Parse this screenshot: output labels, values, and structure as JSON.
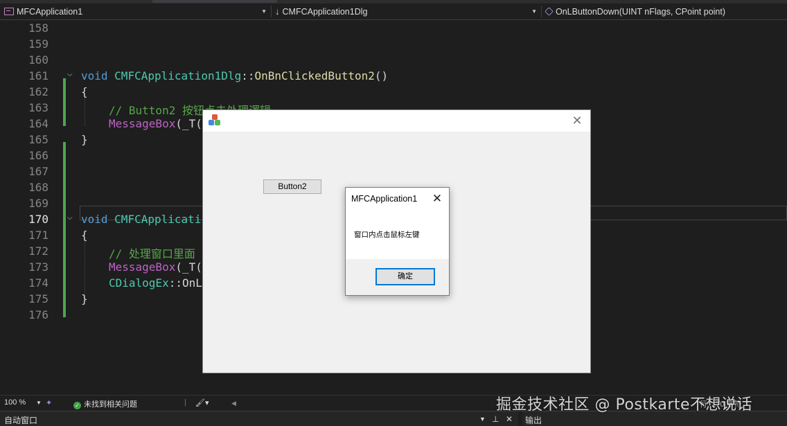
{
  "navbar": {
    "project": "MFCApplication1",
    "class_scope": "CMFCApplication1Dlg",
    "member": "OnLButtonDown(UINT nFlags, CPoint point)"
  },
  "editor": {
    "lines": [
      {
        "num": "158"
      },
      {
        "num": "159"
      },
      {
        "num": "160"
      },
      {
        "num": "161",
        "tokens": [
          {
            "t": "void",
            "c": "kw"
          },
          {
            "t": " "
          },
          {
            "t": "CMFCApplication1Dlg",
            "c": "cls"
          },
          {
            "t": "::"
          },
          {
            "t": "OnBnClickedButton2",
            "c": "fn"
          },
          {
            "t": "()"
          }
        ],
        "fold": true
      },
      {
        "num": "162",
        "tokens": [
          {
            "t": "{"
          }
        ]
      },
      {
        "num": "163",
        "indent": true,
        "tokens": [
          {
            "t": "// Button2 按钮点击处理逻辑",
            "c": "cm"
          }
        ]
      },
      {
        "num": "164",
        "indent": true,
        "tokens": [
          {
            "t": "MessageBox",
            "c": "mac"
          },
          {
            "t": "(_T("
          }
        ]
      },
      {
        "num": "165",
        "tokens": [
          {
            "t": "}"
          }
        ]
      },
      {
        "num": "166"
      },
      {
        "num": "167"
      },
      {
        "num": "168"
      },
      {
        "num": "169"
      },
      {
        "num": "170",
        "active": true,
        "tokens": [
          {
            "t": "void",
            "c": "kw"
          },
          {
            "t": " "
          },
          {
            "t": "CMFCApplicati",
            "c": "cls"
          }
        ],
        "fold": true
      },
      {
        "num": "171",
        "tokens": [
          {
            "t": "{"
          }
        ]
      },
      {
        "num": "172",
        "indent": true,
        "tokens": [
          {
            "t": "// 处理窗口里面",
            "c": "cm"
          }
        ]
      },
      {
        "num": "173",
        "indent": true,
        "tokens": [
          {
            "t": "MessageBox",
            "c": "mac"
          },
          {
            "t": "(_T("
          }
        ]
      },
      {
        "num": "174",
        "indent": true,
        "tokens": [
          {
            "t": "CDialogEx",
            "c": "cls"
          },
          {
            "t": "::OnL"
          }
        ]
      },
      {
        "num": "175",
        "tokens": [
          {
            "t": "}"
          }
        ]
      },
      {
        "num": "176"
      }
    ]
  },
  "app_dialog": {
    "close_glyph": "✕",
    "button2_label": "Button2"
  },
  "message_box": {
    "title": "MFCApplication1",
    "close_glyph": "✕",
    "text": "窗口内点击鼠标左键",
    "ok_label": "确定"
  },
  "status_bar": {
    "zoom": "100 %",
    "issues": "未找到相关问题",
    "right_text": "行: 170   字符"
  },
  "bottom_panels": {
    "left_title": "自动窗口",
    "right_title": "输出"
  },
  "watermark": "掘金技术社区 @ Postkarte不想说话",
  "colors": {
    "editor_bg": "#1e1e1e",
    "keyword": "#569cd6",
    "type": "#4ec9b0",
    "function": "#dcdcaa",
    "macro": "#bd63c5",
    "comment": "#57a64a",
    "change_bar": "#4ba54e",
    "dialog_bg": "#f0f0f0",
    "focus_border": "#0078d7"
  },
  "icons": [
    "project-icon",
    "arrow-down-icon",
    "cube-icon",
    "fold-chevron-icon",
    "mfc-app-icon",
    "close-icon",
    "check-circle-icon"
  ]
}
